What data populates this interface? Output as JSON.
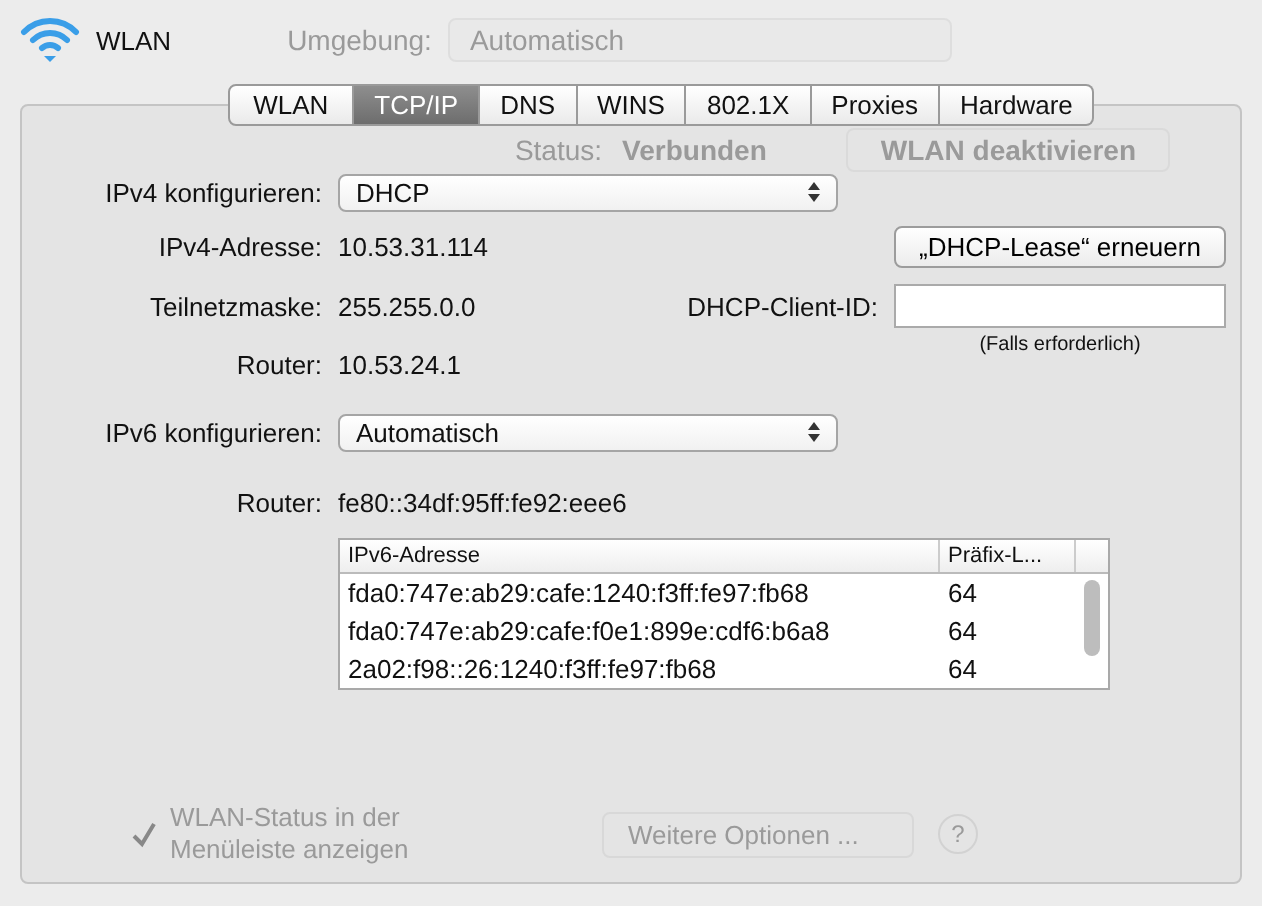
{
  "window": {
    "title": "WLAN"
  },
  "location": {
    "label": "Umgebung:",
    "value": "Automatisch"
  },
  "tabs": [
    {
      "label": "WLAN",
      "selected": false
    },
    {
      "label": "TCP/IP",
      "selected": true
    },
    {
      "label": "DNS",
      "selected": false
    },
    {
      "label": "WINS",
      "selected": false
    },
    {
      "label": "802.1X",
      "selected": false
    },
    {
      "label": "Proxies",
      "selected": false
    },
    {
      "label": "Hardware",
      "selected": false
    }
  ],
  "status": {
    "label": "Status:",
    "value": "Verbunden",
    "button": "WLAN deaktivieren"
  },
  "ipv4": {
    "configure": {
      "label": "IPv4 konfigurieren:",
      "value": "DHCP"
    },
    "address": {
      "label": "IPv4-Adresse:",
      "value": "10.53.31.114"
    },
    "subnet": {
      "label": "Teilnetzmaske:",
      "value": "255.255.0.0"
    },
    "router": {
      "label": "Router:",
      "value": "10.53.24.1"
    },
    "renew_button": "„DHCP-Lease“ erneuern",
    "client_id": {
      "label": "DHCP-Client-ID:",
      "note": "(Falls erforderlich)"
    }
  },
  "ipv6": {
    "configure": {
      "label": "IPv6 konfigurieren:",
      "value": "Automatisch"
    },
    "router": {
      "label": "Router:",
      "value": "fe80::34df:95ff:fe92:eee6"
    },
    "table": {
      "columns": [
        "IPv6-Adresse",
        "Präfix-L..."
      ],
      "rows": [
        [
          "fda0:747e:ab29:cafe:1240:f3ff:fe97:fb68",
          "64"
        ],
        [
          "fda0:747e:ab29:cafe:f0e1:899e:cdf6:b6a8",
          "64"
        ],
        [
          "2a02:f98::26:1240:f3ff:fe97:fb68",
          "64"
        ]
      ]
    }
  },
  "footer": {
    "show_status": {
      "label": "WLAN-Status in der Menüleiste anzeigen",
      "checked": true
    },
    "more_button": "Weitere Optionen ...",
    "help_button": "?"
  }
}
